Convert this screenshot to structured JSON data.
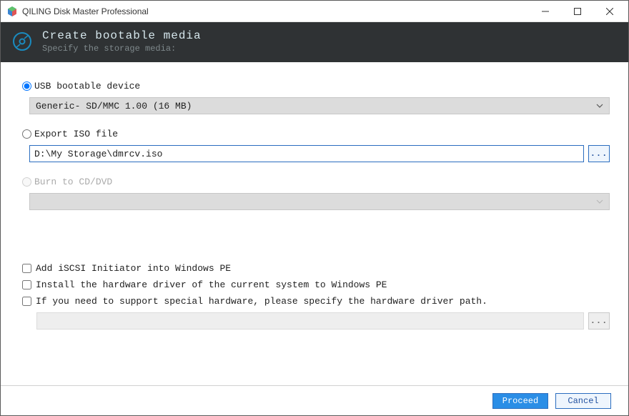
{
  "window": {
    "title": "QILING Disk Master Professional"
  },
  "header": {
    "title": "Create bootable media",
    "subtitle": "Specify the storage media:"
  },
  "options": {
    "usb": {
      "label": "USB bootable device",
      "selected_device": "Generic- SD/MMC 1.00 (16 MB)"
    },
    "iso": {
      "label": "Export ISO file",
      "path": "D:\\My Storage\\dmrcv.iso",
      "browse": "..."
    },
    "cd": {
      "label": "Burn to CD/DVD"
    }
  },
  "checkboxes": {
    "iscsi": "Add iSCSI Initiator into Windows PE",
    "driver_current": "Install the hardware driver of the current system to Windows PE",
    "driver_path": "If you need to support special hardware, please specify the hardware driver path.",
    "driver_browse": "..."
  },
  "footer": {
    "proceed": "Proceed",
    "cancel": "Cancel"
  }
}
